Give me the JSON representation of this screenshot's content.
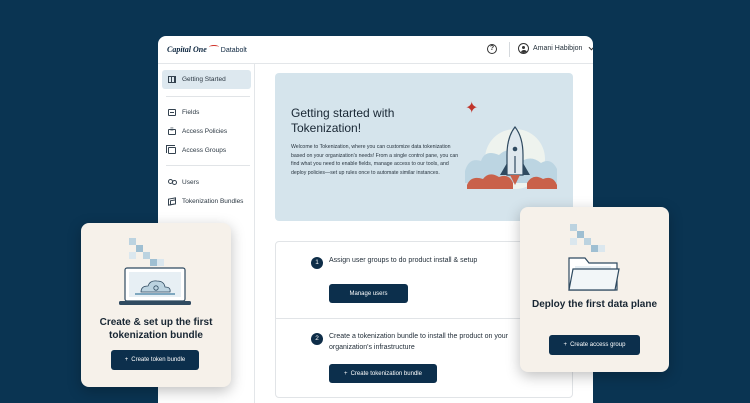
{
  "app": {
    "logo_brand": "Capital",
    "logo_brand_suffix": "One",
    "logo_product": "Databolt",
    "help_label": "?",
    "user_name": "Amani Habibjon"
  },
  "sidebar": {
    "items": [
      {
        "label": "Getting Started",
        "icon": "map-icon"
      },
      {
        "label": "Fields",
        "icon": "fields-icon"
      },
      {
        "label": "Access Policies",
        "icon": "policy-icon"
      },
      {
        "label": "Access Groups",
        "icon": "groups-icon"
      },
      {
        "label": "Users",
        "icon": "users-icon"
      },
      {
        "label": "Tokenization Bundles",
        "icon": "bundle-icon"
      }
    ]
  },
  "hero": {
    "title": "Getting started with Tokenization!",
    "body": "Welcome to Tokenization, where you can customize data tokenization based on your organization's needs! From a single control pane, you can find what you need to enable fields, manage access to our tools, and deploy policies—set up rules once to automate similar instances."
  },
  "steps": [
    {
      "number": "1",
      "text": "Assign user groups to do product install & setup",
      "button": "Manage users"
    },
    {
      "number": "2",
      "text": "Create a tokenization bundle to install the product on your organization's infrastructure",
      "button": "Create tokenization bundle"
    }
  ],
  "cards": {
    "left": {
      "title": "Create & set up the first tokenization bundle",
      "button": "Create token bundle"
    },
    "right": {
      "title": "Deploy the first data plane",
      "button": "Create access group"
    }
  },
  "colors": {
    "background": "#0a3452",
    "primary_button": "#0c2f4c",
    "hero_bg": "#d5e4ec",
    "accent": "#c0342b",
    "card_bg": "#f6f1ea"
  }
}
